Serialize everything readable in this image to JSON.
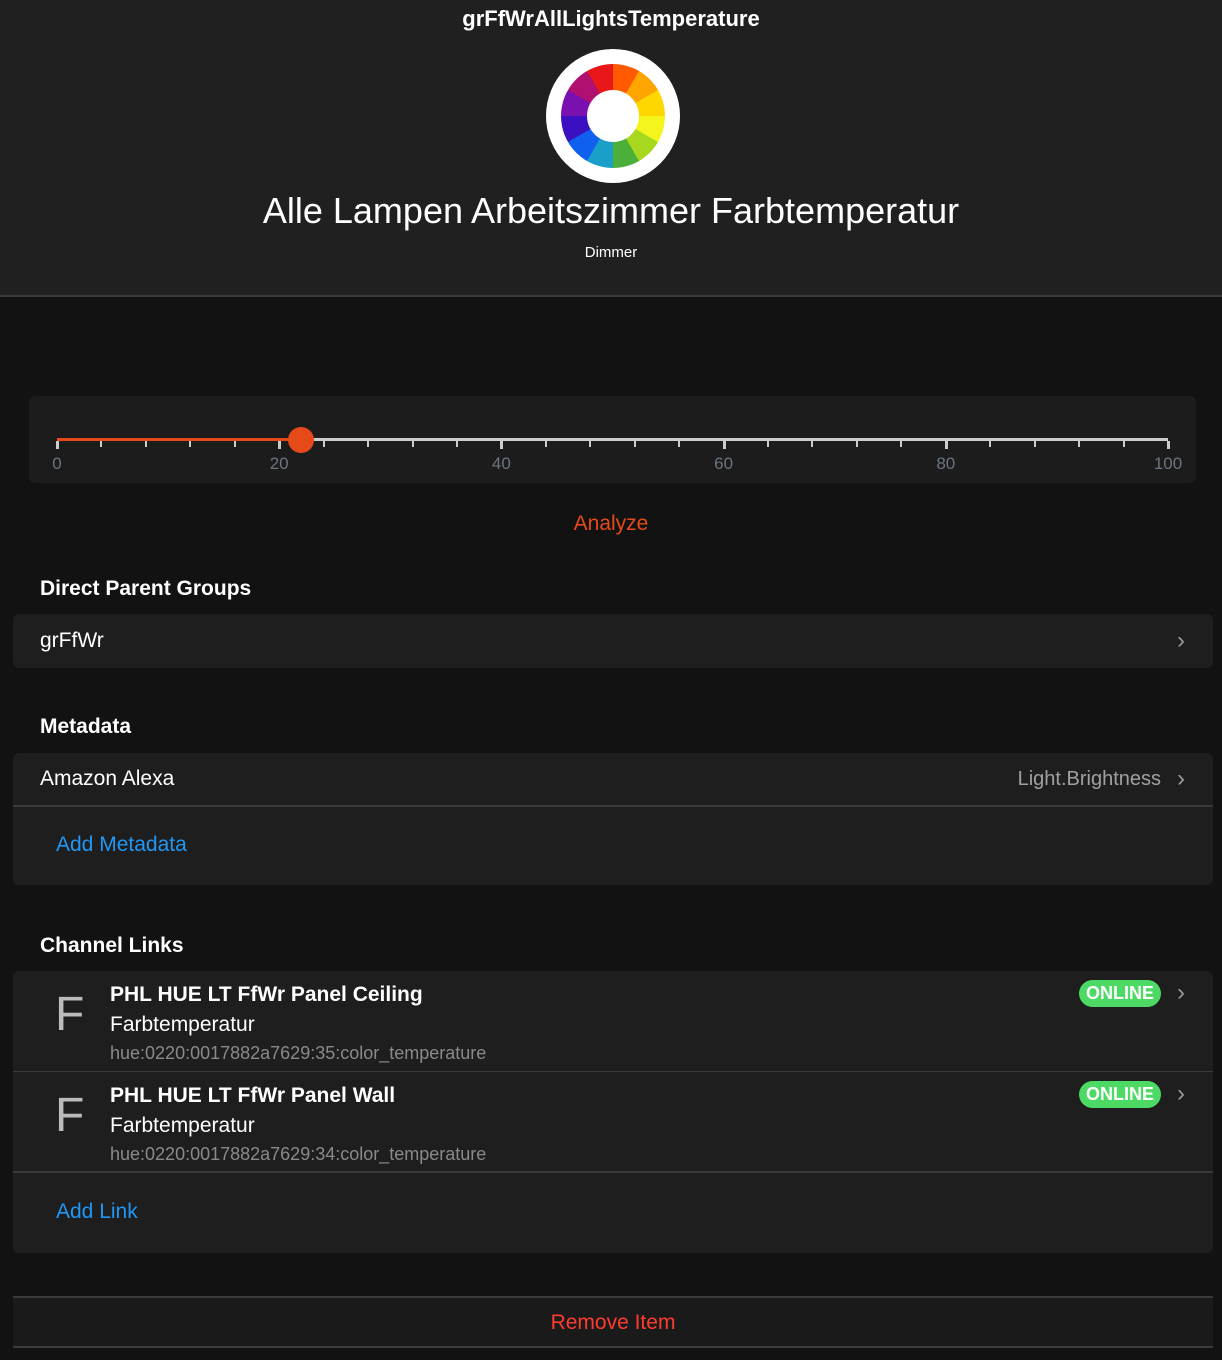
{
  "header": {
    "name": "grFfWrAllLightsTemperature",
    "label": "Alle Lampen Arbeitszimmer Farbtemperatur",
    "type": "Dimmer",
    "icon": "color-wheel-icon"
  },
  "slider": {
    "value": 22,
    "min": 0,
    "max": 100,
    "tick_labels": [
      "0",
      "20",
      "40",
      "60",
      "80",
      "100"
    ],
    "accent": "#e64a19"
  },
  "analyze_label": "Analyze",
  "parent_groups": {
    "title": "Direct Parent Groups",
    "items": [
      {
        "label": "grFfWr"
      }
    ]
  },
  "metadata": {
    "title": "Metadata",
    "items": [
      {
        "label": "Amazon Alexa",
        "value": "Light.Brightness"
      }
    ],
    "add_label": "Add Metadata"
  },
  "channel_links": {
    "title": "Channel Links",
    "items": [
      {
        "icon_letter": "F",
        "thing": "PHL HUE LT FfWr Panel Ceiling",
        "channel": "Farbtemperatur",
        "uid": "hue:0220:0017882a7629:35:color_temperature",
        "status": "ONLINE"
      },
      {
        "icon_letter": "F",
        "thing": "PHL HUE LT FfWr Panel Wall",
        "channel": "Farbtemperatur",
        "uid": "hue:0220:0017882a7629:34:color_temperature",
        "status": "ONLINE"
      }
    ],
    "add_label": "Add Link"
  },
  "remove_label": "Remove Item"
}
